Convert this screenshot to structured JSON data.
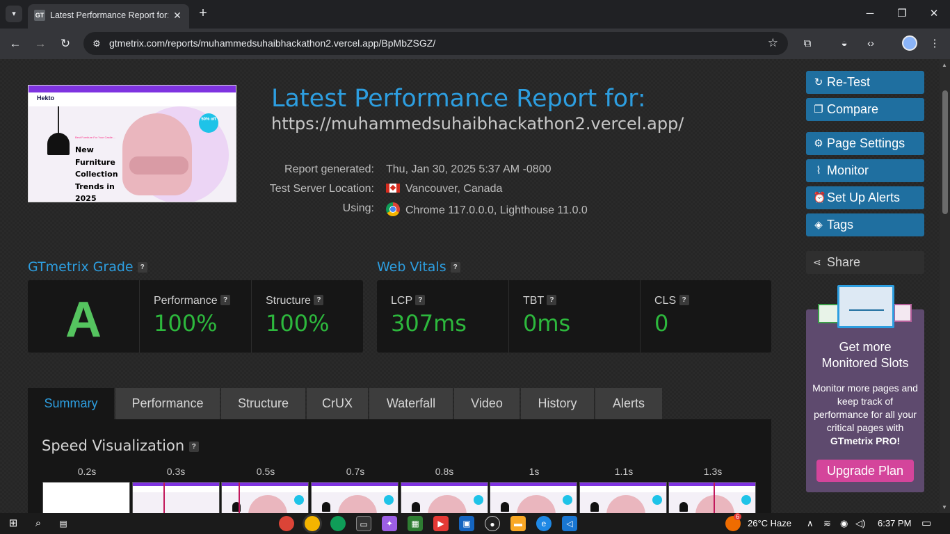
{
  "browser": {
    "tab_title": "Latest Performance Report for: h",
    "favicon_text": "GT",
    "url": "gtmetrix.com/reports/muhammedsuhaibhackathon2.vercel.app/BpMbZSGZ/"
  },
  "thumbnail": {
    "brand": "Hekto",
    "subtitle": "Best Furniture For Your Castle....",
    "headline_lines": [
      "New",
      "Furniture",
      "Collection",
      "Trends in",
      "2025"
    ],
    "badge": "50% off"
  },
  "header": {
    "title": "Latest Performance Report for:",
    "url": "https://muhammedsuhaibhackathon2.vercel.app/"
  },
  "meta": {
    "generated_label": "Report generated:",
    "generated_value": "Thu, Jan 30, 2025 5:37 AM -0800",
    "location_label": "Test Server Location:",
    "location_value": "Vancouver, Canada",
    "using_label": "Using:",
    "using_value": "Chrome 117.0.0.0, Lighthouse 11.0.0"
  },
  "grade": {
    "heading": "GTmetrix Grade",
    "letter": "A",
    "performance_label": "Performance",
    "performance_value": "100%",
    "structure_label": "Structure",
    "structure_value": "100%"
  },
  "vitals": {
    "heading": "Web Vitals",
    "lcp_label": "LCP",
    "lcp_value": "307ms",
    "tbt_label": "TBT",
    "tbt_value": "0ms",
    "cls_label": "CLS",
    "cls_value": "0"
  },
  "tabs": [
    "Summary",
    "Performance",
    "Structure",
    "CrUX",
    "Waterfall",
    "Video",
    "History",
    "Alerts"
  ],
  "speed": {
    "title": "Speed Visualization",
    "times": [
      "0.2s",
      "0.3s",
      "0.5s",
      "0.7s",
      "0.8s",
      "1s",
      "1.1s",
      "1.3s"
    ]
  },
  "sidebar": {
    "retest": "Re-Test",
    "compare": "Compare",
    "page_settings": "Page Settings",
    "monitor": "Monitor",
    "alerts": "Set Up Alerts",
    "tags": "Tags",
    "share": "Share"
  },
  "promo": {
    "title_line1": "Get more",
    "title_line2": "Monitored Slots",
    "text": "Monitor more pages and keep track of performance for all your critical pages with",
    "brand": "GTmetrix PRO!",
    "button": "Upgrade Plan"
  },
  "taskbar": {
    "weather": "26°C  Haze",
    "time": "6:37 PM",
    "notification_count": "6"
  },
  "colors": {
    "accent_blue": "#2d9ee0",
    "grade_green": "#55c45f",
    "value_green": "#2db83d",
    "button_blue": "#1f6fa0",
    "upgrade_pink": "#d4459b"
  }
}
